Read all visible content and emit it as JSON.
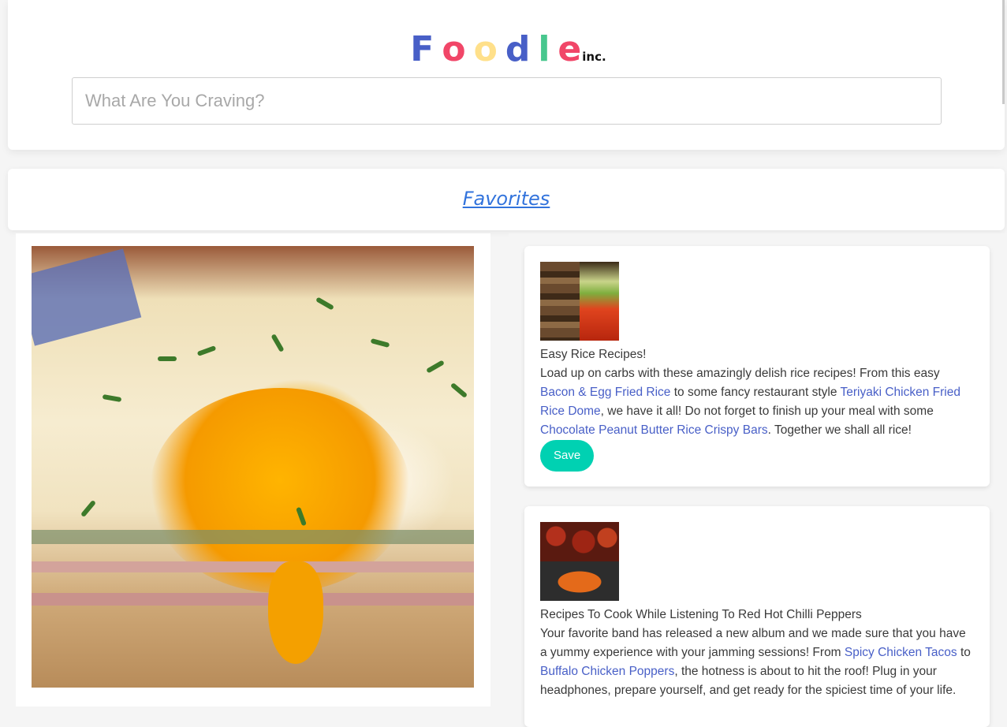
{
  "brand": {
    "letters": [
      {
        "char": "F",
        "color": "#485fc7"
      },
      {
        "char": "o",
        "color": "#f14668"
      },
      {
        "char": "o",
        "color": "#ffe08a"
      },
      {
        "char": "d",
        "color": "#485fc7"
      },
      {
        "char": "l",
        "color": "#48c78e"
      },
      {
        "char": "e",
        "color": "#f14668"
      }
    ],
    "suffix": "inc."
  },
  "search": {
    "placeholder": "What Are You Craving?",
    "value": ""
  },
  "nav": {
    "favorites_label": "Favorites"
  },
  "hero": {
    "icon": "food-photo-egg-sandwich"
  },
  "cards": [
    {
      "title": "Easy Rice Recipes!",
      "intro": "Load up on carbs with these amazingly delish rice recipes! From this easy ",
      "link1": "Bacon & Egg Fried Rice",
      "mid1": " to some fancy restaurant style ",
      "link2": "Teriyaki Chicken Fried Rice Dome",
      "mid2": ", we have it all! Do not forget to finish up your meal with some ",
      "link3": "Chocolate Peanut Butter Rice Crispy Bars",
      "outro": ". Together we shall all rice!",
      "save_label": "Save"
    },
    {
      "title": "Recipes To Cook While Listening To Red Hot Chilli Peppers",
      "intro": "Your favorite band has released a new album and we made sure that you have a yummy experience with your jamming sessions! From ",
      "link1": "Spicy Chicken Tacos",
      "mid1": " to ",
      "link2": "Buffalo Chicken Poppers",
      "outro": ", the hotness is about to hit the roof! Plug in your headphones, prepare yourself, and get ready for the spiciest time of your life."
    }
  ],
  "colors": {
    "accent": "#00d1b2",
    "link": "#485fc7",
    "nav_link": "#3273dc"
  }
}
